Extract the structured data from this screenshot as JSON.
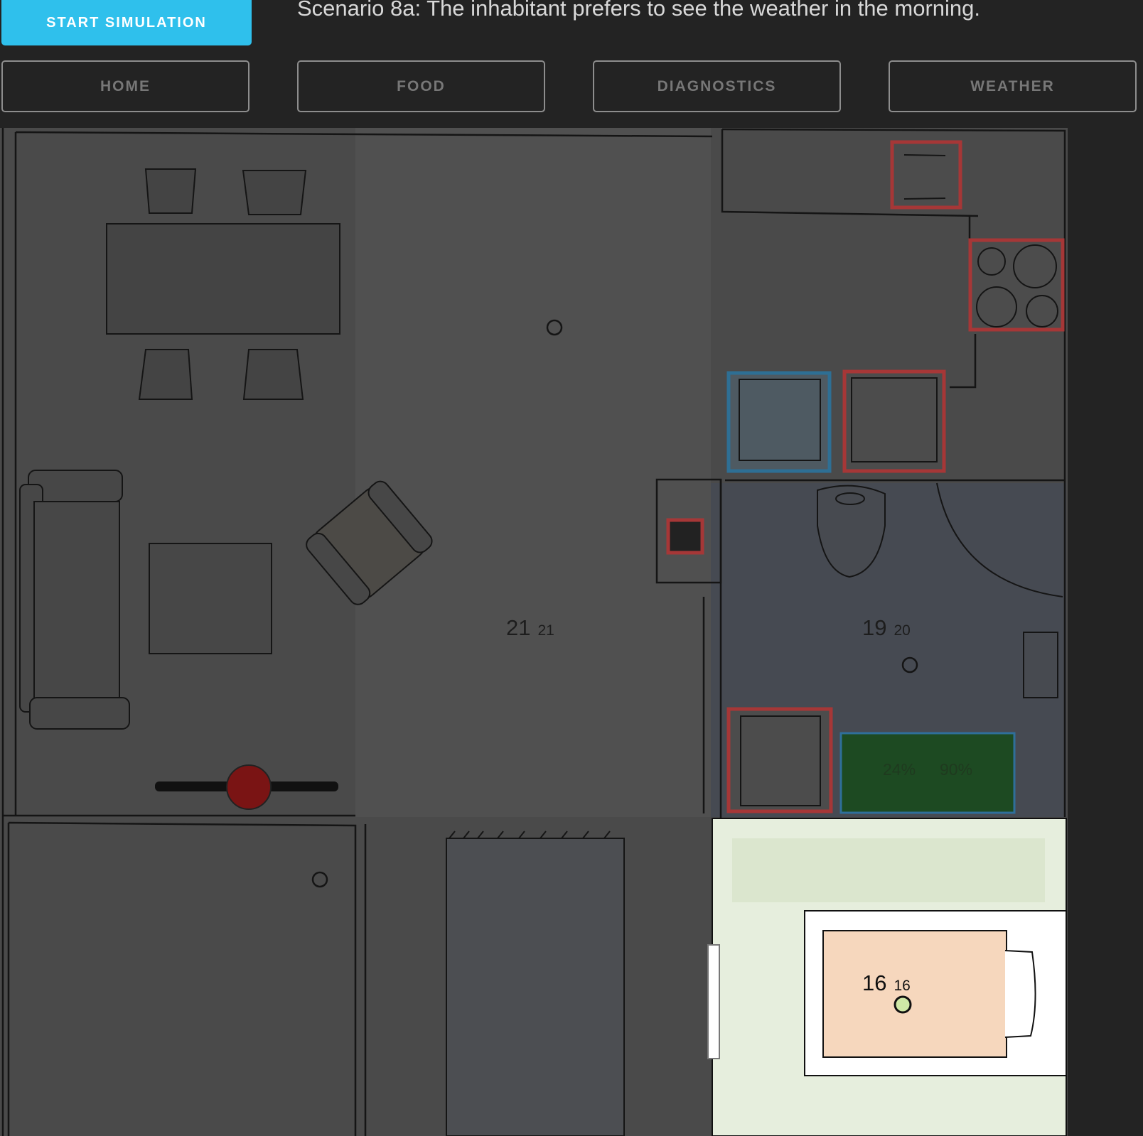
{
  "toolbar": {
    "start_label": "START SIMULATION",
    "scenario_text": "Scenario 8a: The inhabitant prefers to see the weather in the morning."
  },
  "nav": {
    "home": "HOME",
    "food": "FOOD",
    "diagnostics": "DIAGNOSTICS",
    "weather": "WEATHER"
  },
  "rooms": {
    "living": {
      "temp": "21",
      "target": "21"
    },
    "bathroom": {
      "temp": "19",
      "target": "20"
    },
    "bedroom": {
      "temp": "16",
      "target": "16"
    }
  },
  "sensors": {
    "moisture_a": "24%",
    "moisture_b": "90%"
  },
  "colors": {
    "accent": "#2fc0ec",
    "appliance_outline": "#c23a3a",
    "fridge_outline": "#2f8fc4",
    "plant_fill": "#2e7d32",
    "bed_fill": "#f6d7bd",
    "bedroom_lit": "#ffffff"
  }
}
